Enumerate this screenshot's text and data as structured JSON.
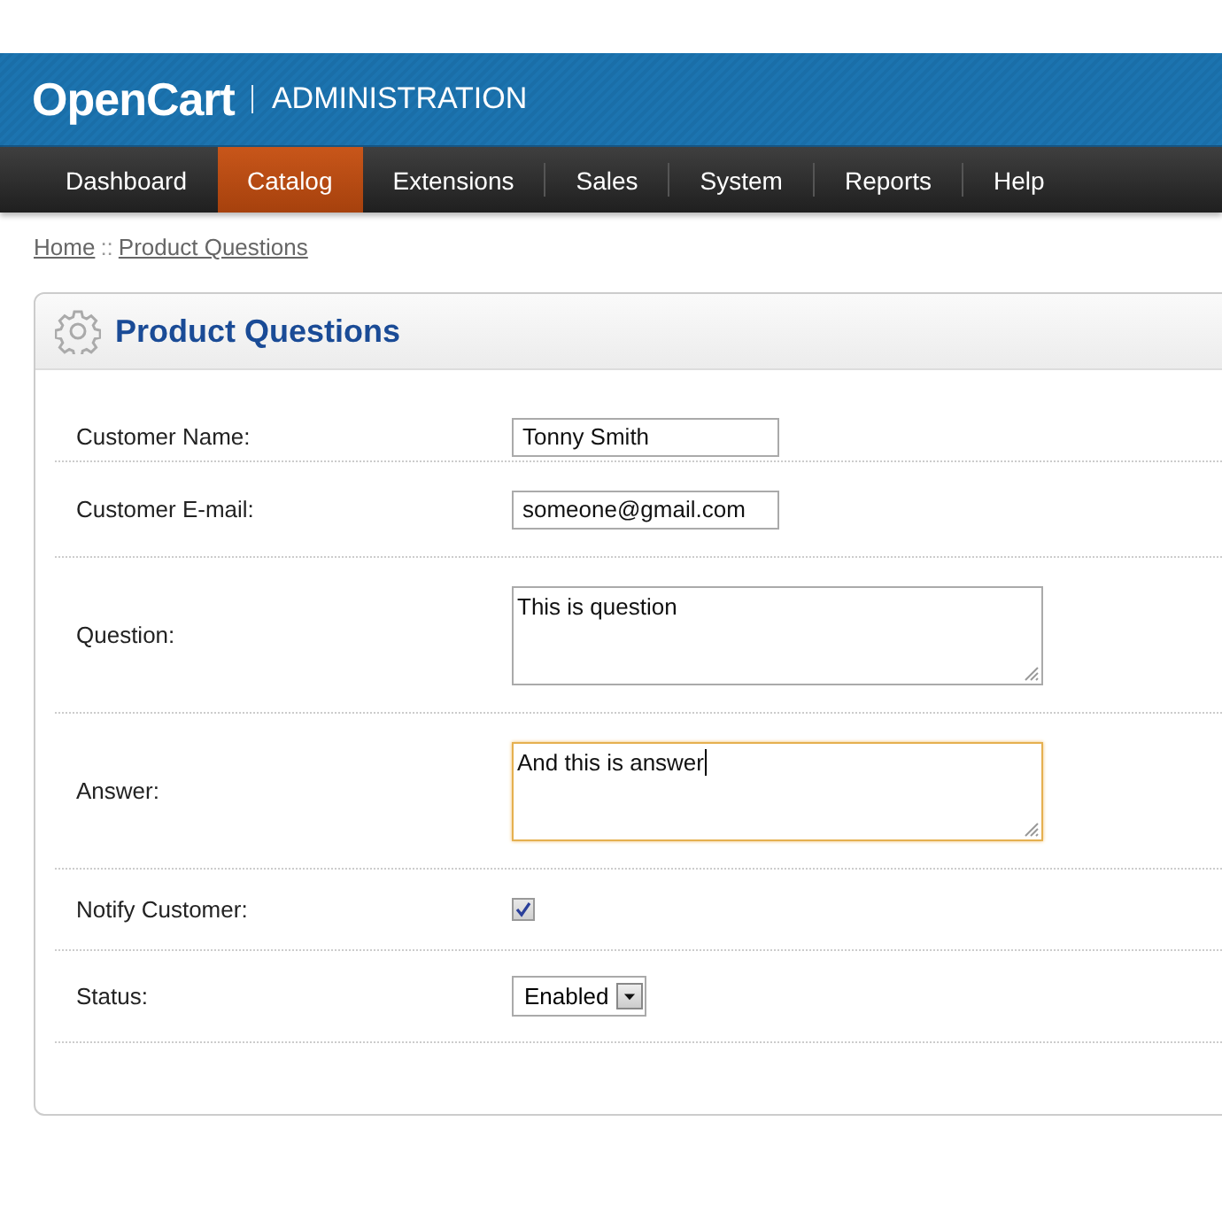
{
  "header": {
    "logo": "OpenCart",
    "subtitle": "ADMINISTRATION"
  },
  "nav": [
    {
      "label": "Dashboard",
      "selected": false
    },
    {
      "label": "Catalog",
      "selected": true
    },
    {
      "label": "Extensions",
      "selected": false
    },
    {
      "label": "Sales",
      "selected": false
    },
    {
      "label": "System",
      "selected": false
    },
    {
      "label": "Reports",
      "selected": false
    },
    {
      "label": "Help",
      "selected": false
    }
  ],
  "breadcrumb": [
    {
      "label": "Home"
    },
    {
      "label": "::"
    },
    {
      "label": "Product Questions"
    }
  ],
  "panel": {
    "title": "Product Questions",
    "fields": [
      {
        "kind": "text",
        "label": "Customer Name:",
        "value": "Tonny Smith"
      },
      {
        "kind": "text",
        "label": "Customer E-mail:",
        "value": "someone@gmail.com"
      },
      {
        "kind": "textarea",
        "label": "Question:",
        "value": "This is question",
        "focused": false
      },
      {
        "kind": "textarea",
        "label": "Answer:",
        "value": "And this is answer",
        "focused": true
      },
      {
        "kind": "checkbox",
        "label": "Notify Customer:",
        "checked": true
      },
      {
        "kind": "select",
        "label": "Status:",
        "value": "Enabled"
      }
    ]
  }
}
